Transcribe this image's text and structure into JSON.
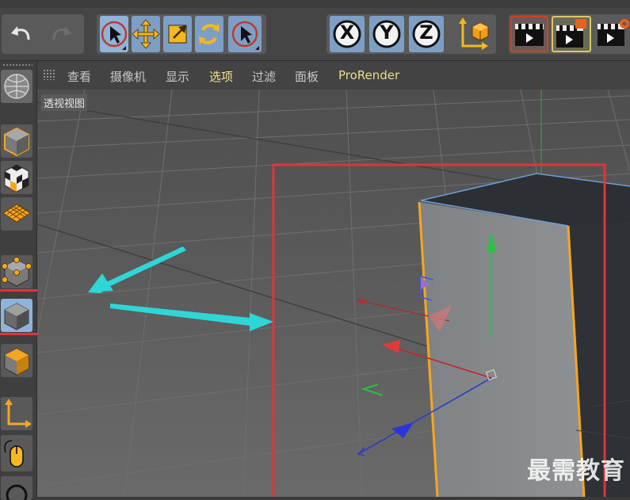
{
  "viewport_menu": {
    "items": [
      "查看",
      "摄像机",
      "显示",
      "选项",
      "过滤",
      "面板",
      "ProRender"
    ],
    "active": "选项"
  },
  "viewport": {
    "label": "透视视图"
  },
  "toolbar": {
    "axis_x": "X",
    "axis_y": "Y",
    "axis_z": "Z"
  },
  "watermark": "最需教育",
  "colors": {
    "highlight_frame": "#e2333a",
    "arrow": "#2fd6d6",
    "selection_edge": "#f4a620",
    "tool_selected": "#8fb3d9"
  },
  "icons": [
    "undo-icon",
    "redo-icon",
    "live-selection-icon",
    "move-icon",
    "scale-icon",
    "rotate-icon",
    "recent-tool-icon",
    "axis-lock-x-icon",
    "axis-lock-y-icon",
    "axis-lock-z-icon",
    "coordinate-system-icon",
    "render-view-icon",
    "render-picture-viewer-icon",
    "edit-render-settings-icon",
    "make-editable-icon",
    "model-mode-icon",
    "texture-mode-icon",
    "workplane-mode-icon",
    "points-mode-icon",
    "polygons-mode-icon",
    "edges-mode-icon",
    "object-axis-icon",
    "tweak-mode-icon"
  ]
}
